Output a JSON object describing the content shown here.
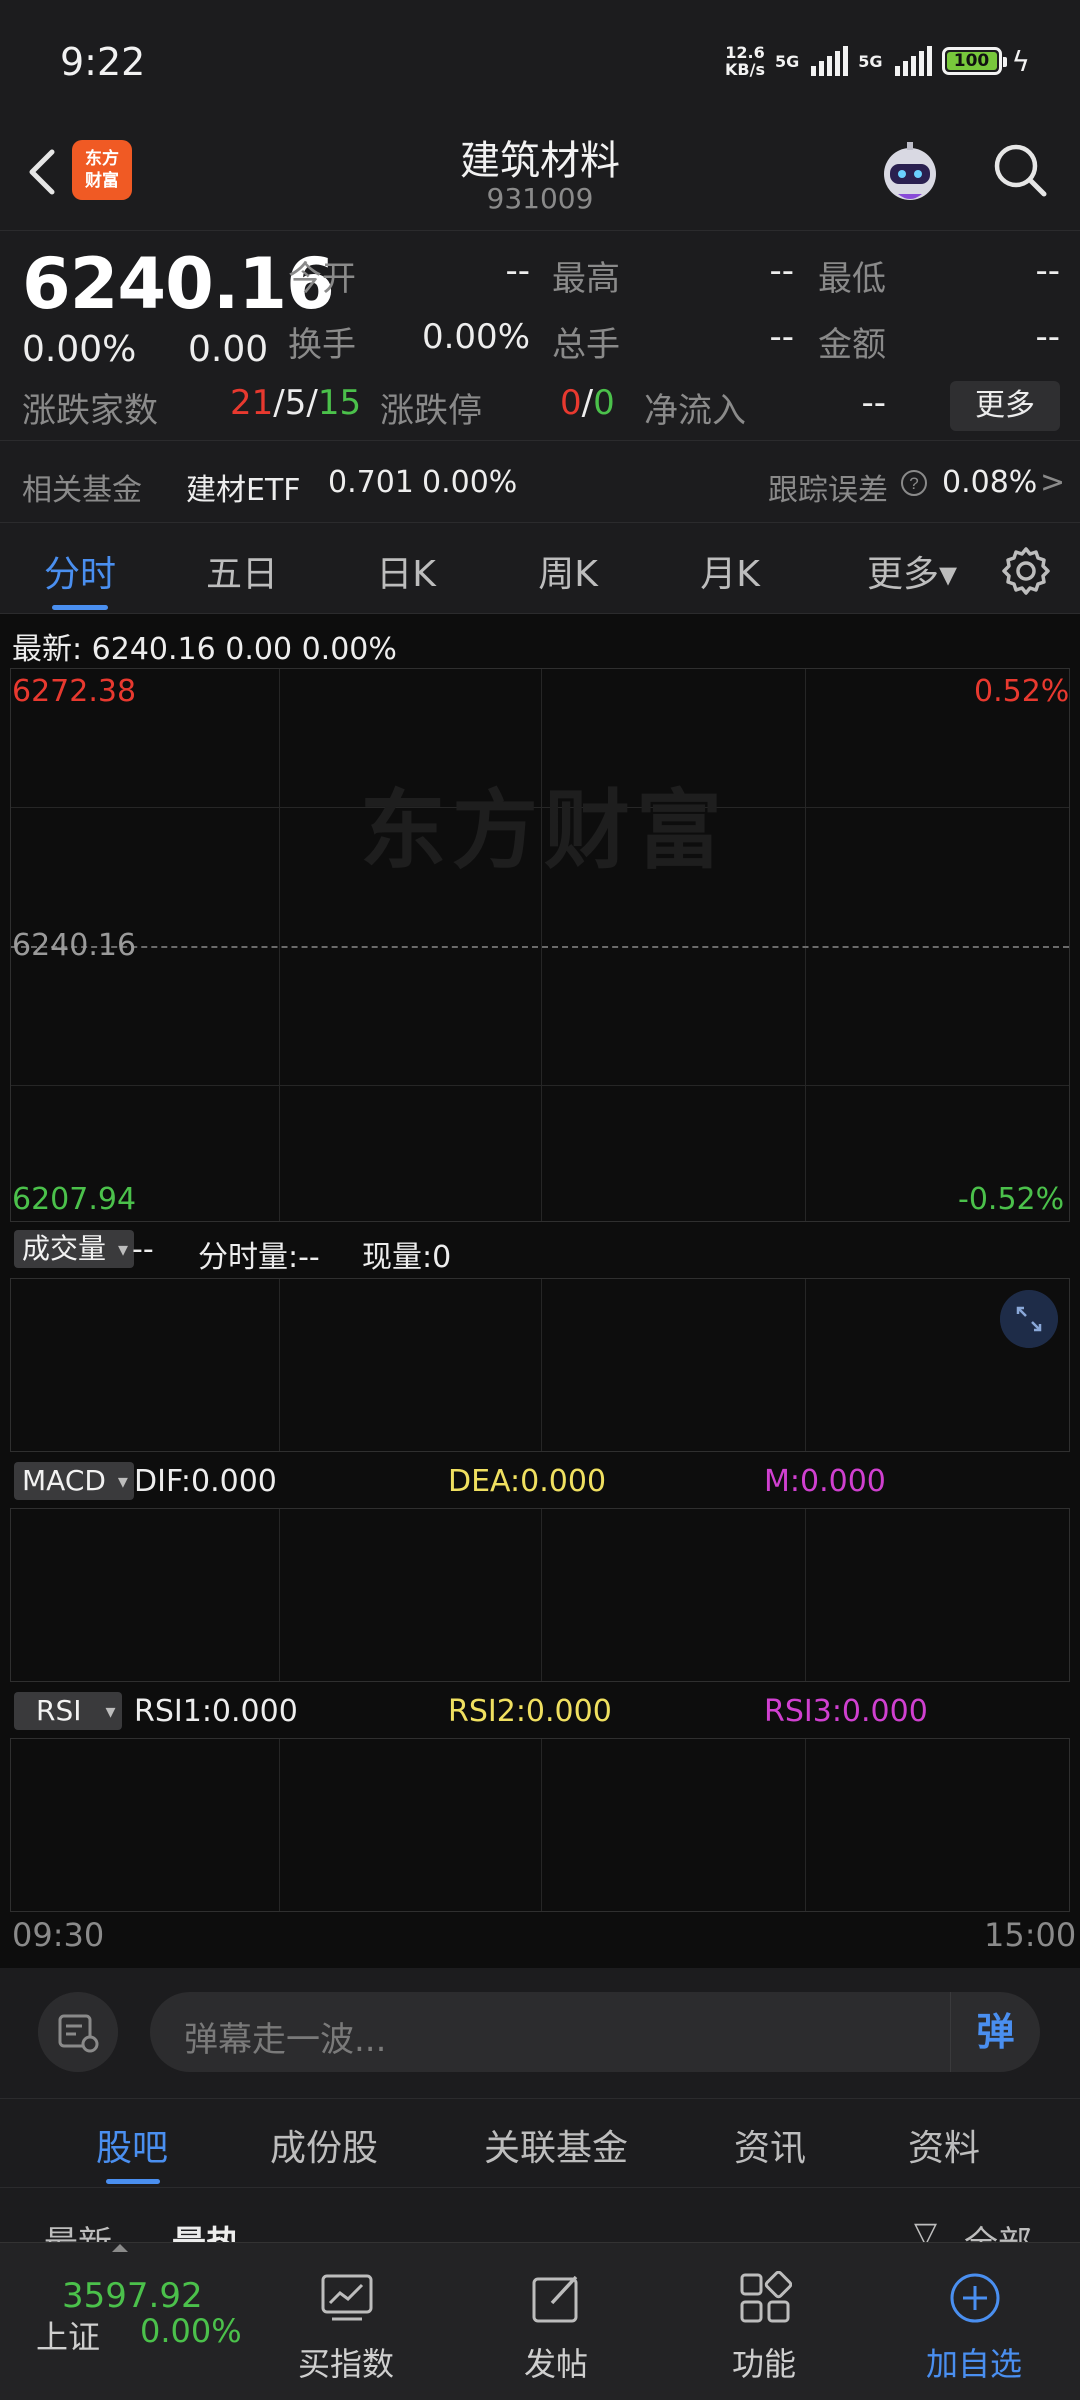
{
  "status": {
    "time": "9:22",
    "net_speed_top": "12.6",
    "net_speed_bottom": "KB/s",
    "sig1": "5G",
    "sig2": "5G",
    "battery": "100"
  },
  "header": {
    "title": "建筑材料",
    "code": "931009",
    "logo_line1": "东方",
    "logo_line2": "财富"
  },
  "quote": {
    "price": "6240.16",
    "change_pct": "0.00%",
    "change_val": "0.00",
    "open_label": "今开",
    "open_val": "--",
    "high_label": "最高",
    "high_val": "--",
    "low_label": "最低",
    "low_val": "--",
    "turnover_label": "换手",
    "turnover_val": "0.00%",
    "volume_label": "总手",
    "volume_val": "--",
    "amount_label": "金额",
    "amount_val": "--",
    "updown_label": "涨跌家数",
    "up_count": "21",
    "flat_count": "5",
    "down_count": "15",
    "sep": "/",
    "limit_label": "涨跌停",
    "limit_up": "0",
    "limit_down": "0",
    "netflow_label": "净流入",
    "netflow_val": "--",
    "more_label": "更多"
  },
  "fund": {
    "label": "相关基金",
    "name": "建材ETF",
    "price": "0.701",
    "pct": "0.00%",
    "track_label": "跟踪误差",
    "track_val": "0.08%",
    "arrow": ">"
  },
  "chart_tabs": [
    "分时",
    "五日",
    "日K",
    "周K",
    "月K",
    "更多▾"
  ],
  "chart": {
    "latest_text": "最新:  6240.16   0.00   0.00%",
    "watermark": "东方财富",
    "y_top": "6272.38",
    "y_mid": "6240.16",
    "y_bottom": "6207.94",
    "pct_top": "0.52%",
    "pct_bottom": "-0.52%",
    "time_start": "09:30",
    "time_end": "15:00"
  },
  "volume": {
    "select": "成交量",
    "dash": "--",
    "period_label": "分时量:--",
    "now_label": "现量:0"
  },
  "macd": {
    "select": "MACD",
    "dif": "DIF:0.000",
    "dea": "DEA:0.000",
    "m": "M:0.000"
  },
  "rsi": {
    "select": "RSI",
    "rsi1": "RSI1:0.000",
    "rsi2": "RSI2:0.000",
    "rsi3": "RSI3:0.000"
  },
  "danmaku": {
    "placeholder": "弹幕走一波...",
    "send": "弹"
  },
  "sub_tabs": [
    "股吧",
    "成份股",
    "关联基金",
    "资讯",
    "资料"
  ],
  "peek": {
    "latest": "最新",
    "hot": "最热",
    "all": "全部"
  },
  "bottom_nav": {
    "index_price": "3597.92",
    "index_name": "上证",
    "index_pct": "0.00%",
    "items": [
      "买指数",
      "发帖",
      "功能",
      "加自选"
    ]
  },
  "colors": {
    "up": "#e8392f",
    "down": "#4bc14b",
    "accent": "#4a8ff0",
    "dea": "#f0e060",
    "m": "#d040d0"
  }
}
